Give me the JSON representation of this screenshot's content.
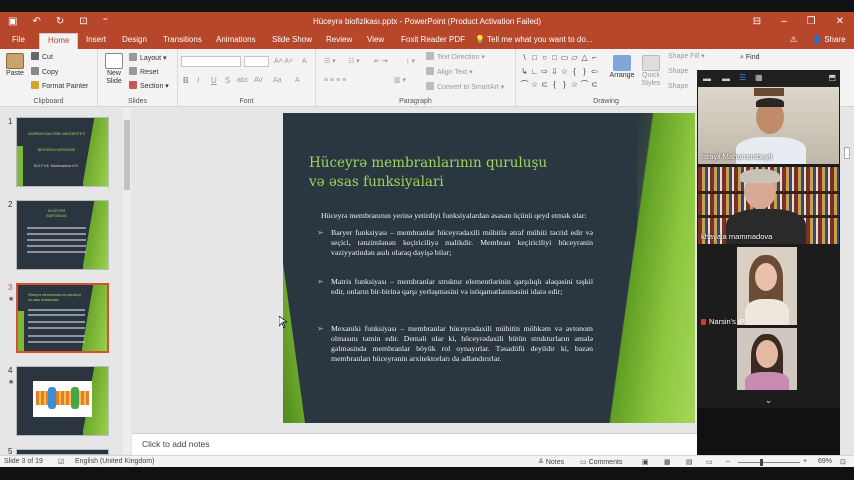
{
  "window": {
    "title": "Hüceyrə biofizikası.pptx - PowerPoint (Product Activation Failed)",
    "qat": [
      "save-icon",
      "undo-icon",
      "redo-icon",
      "present-icon",
      "customize-icon"
    ],
    "controls": [
      "ribbon-display-icon",
      "minimize-icon",
      "restore-icon",
      "close-icon"
    ]
  },
  "tabs": [
    "File",
    "Home",
    "Insert",
    "Design",
    "Transitions",
    "Animations",
    "Slide Show",
    "Review",
    "View",
    "Foxit Reader PDF"
  ],
  "tell_me": "Tell me what you want to do...",
  "share": "Share",
  "ribbon": {
    "clipboard": {
      "paste": "Paste",
      "cut": "Cut",
      "copy": "Copy",
      "format_painter": "Format Painter",
      "label": "Clipboard"
    },
    "slides": {
      "new_slide": "New Slide",
      "layout": "Layout",
      "reset": "Reset",
      "section": "Section",
      "label": "Slides"
    },
    "font": {
      "bold": "B",
      "italic": "I",
      "underline": "U",
      "strike": "S",
      "shadow": "abc",
      "spacing": "AV",
      "case": "Aa",
      "color": "A",
      "label": "Font"
    },
    "paragraph": {
      "text_direction": "Text Direction",
      "align_text": "Align Text",
      "smartart": "Convert to SmartArt",
      "label": "Paragraph"
    },
    "drawing": {
      "arrange": "Arrange",
      "quick_styles": "Quick Styles",
      "shape_fill": "Shape Fill",
      "shape_outline": "Shape",
      "shape_effects": "Shape",
      "label": "Drawing"
    },
    "editing": {
      "find": "Find"
    },
    "shape_glyphs": [
      "\\",
      "□",
      "○",
      "□",
      "▭",
      "▱",
      "△",
      "⌐",
      "↳",
      "∟",
      "⇨",
      "⇩",
      "☆",
      "{",
      "}",
      "⇦",
      "⌒",
      "☆",
      "⊂",
      "{",
      "}",
      "☆",
      "⌒",
      "⊂"
    ]
  },
  "thumbnails": [
    {
      "num": "1",
      "title_lines": [
        "AZƏRBAYCAN TİBB UNİVERSİTETİ",
        "BİOFİZİKA KAFEDRASI",
        "B.Ü.F.V.E. Məmmədova X.R."
      ],
      "star": ""
    },
    {
      "num": "2",
      "title_lines": [
        "HÜCEYRƏ",
        "BİOFİZİKASI"
      ],
      "star": ""
    },
    {
      "num": "3",
      "title_lines": [
        "Hüceyrə membranlarının quruluşu",
        "və əsas funksiyalari"
      ],
      "star": "★"
    },
    {
      "num": "4",
      "title_lines": [],
      "star": "★"
    },
    {
      "num": "5",
      "title_lines": [],
      "star": ""
    }
  ],
  "slide": {
    "title_line1": "Hüceyrə membranlarının quruluşu",
    "title_line2": "və əsas funksiyalari",
    "intro": "Hüceyrə membranının yerinə yetirdiyi funksiyalardan əsasən üçünü qeyd etmək olar:",
    "bullets": [
      "Baryer funksiyası – membranlar hüceyrədaxili mühitlə ətraf mühiti təcrid edir və seçici, tənzimlənən keçiriciliyə malikdir. Membran keçiriciliyi hüceyrənin vəziyyətindən asılı olaraq dəyişə bilər;",
      "Matris funksiyası – membranlar struktur elementlərinin qarşılıqlı əlaqəsini təşkil edir, onların bir-birinə qarşı yerləşməsini və istiqamətlənməsini idarə edir;",
      "Mexaniki funksiyası – membranlar hüceyrədaxili mühitin möhkəm və avtonom olmasını təmin edir. Deməli olar ki, hüceyrədaxili bütün strukturların əmələ gəlməsində membranlar böyük rol oynayırlar. Təsadüfü deyildir ki, bəzən membranları hüceyrənin arxitektorları da adlandırırlar."
    ]
  },
  "notes_placeholder": "Click to add notes",
  "status": {
    "slide_of": "Slide 3 of 19",
    "language": "English (United Kingdom)",
    "notes": "Notes",
    "comments": "Comments",
    "zoom": "69%"
  },
  "participants": [
    {
      "name": "İsrayil Maharrambayli",
      "muted": false
    },
    {
      "name": "khayala mammadova",
      "muted": false
    },
    {
      "name": "Narsin's iPhone",
      "muted": true
    },
    {
      "name": "",
      "muted": false
    }
  ],
  "colors": {
    "accent": "#b7472a",
    "slide_bg": "#2b3740",
    "slide_green": "#8cc63e",
    "title_green": "#9fd35a"
  }
}
